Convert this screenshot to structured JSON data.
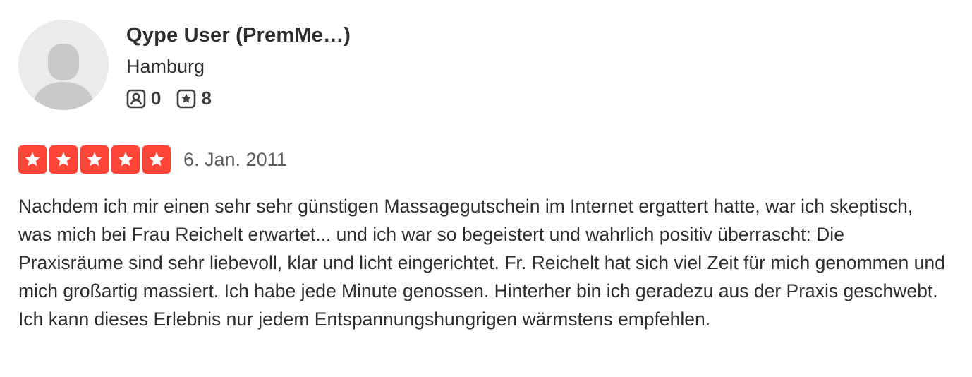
{
  "user": {
    "name": "Qype User (PremMe…)",
    "location": "Hamburg",
    "friends_count": "0",
    "reviews_count": "8",
    "avatar_icon": "default-avatar-icon",
    "friends_icon": "friends-icon",
    "reviews_icon": "reviews-star-icon"
  },
  "review": {
    "rating": 5,
    "max_rating": 5,
    "star_color": "#ff4438",
    "date": "6. Jan. 2011",
    "text": "Nachdem ich mir einen sehr sehr günstigen Massagegutschein im Internet ergattert hatte, war ich skeptisch, was mich bei Frau Reichelt erwartet... und ich war so begeistert und wahrlich positiv überrascht: Die Praxisräume sind sehr liebevoll, klar und licht eingerichtet. Fr. Reichelt hat sich viel Zeit für mich genommen und mich großartig massiert. Ich habe jede Minute genossen. Hinterher bin ich geradezu aus der Praxis geschwebt. Ich kann dieses Erlebnis nur jedem Entspannungshungrigen wärmstens empfehlen."
  }
}
